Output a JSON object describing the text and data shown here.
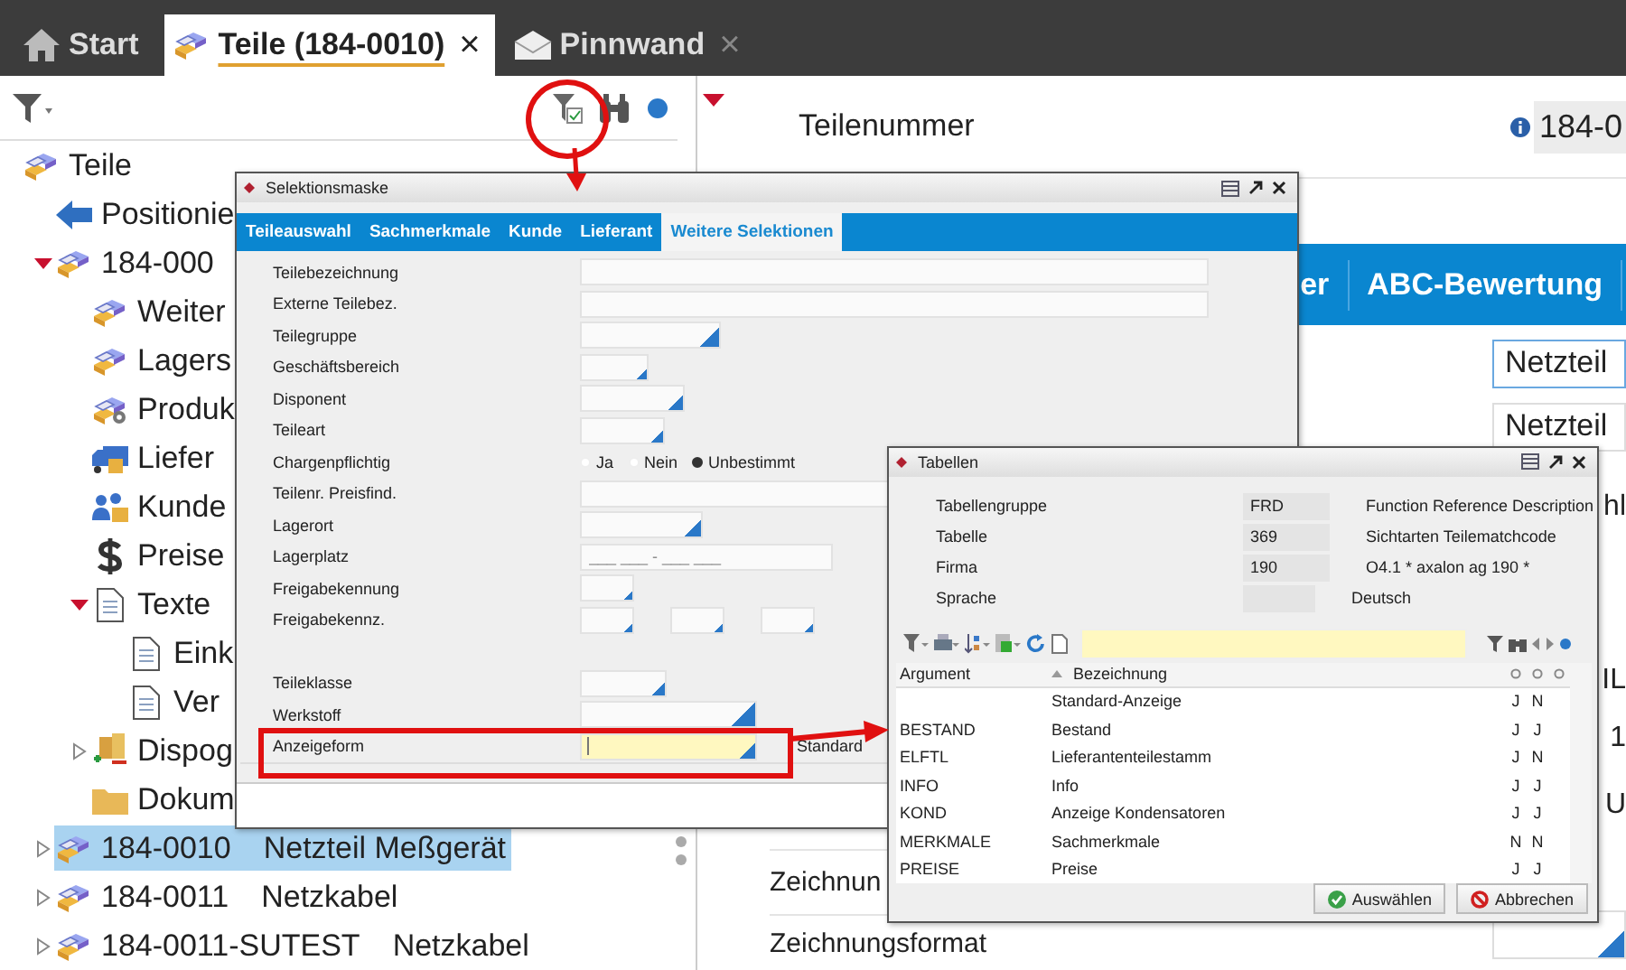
{
  "tabs": [
    {
      "label": "Start",
      "kind": "home",
      "selected": false
    },
    {
      "label": "Teile (184-0010)",
      "kind": "parts",
      "selected": true,
      "close": "×"
    },
    {
      "label": "Pinnwand",
      "kind": "mail",
      "selected": false,
      "close": "×"
    }
  ],
  "tree": [
    {
      "label": "Teile",
      "kind": "parts",
      "selected": false,
      "children": [
        {
          "label": "Positionie",
          "kind": "arrow",
          "selected": false
        },
        {
          "label": "184-000",
          "kind": "parts",
          "selected": false,
          "expanded": true,
          "children": [
            {
              "label": "Weiter",
              "kind": "parts",
              "selected": false
            },
            {
              "label": "Lagers",
              "kind": "parts",
              "selected": false
            },
            {
              "label": "Produk",
              "kind": "parts-gear",
              "selected": false
            },
            {
              "label": "Liefer",
              "kind": "truck",
              "selected": false
            },
            {
              "label": "Kunde",
              "kind": "people",
              "selected": false
            },
            {
              "label": "Preise",
              "kind": "dollar",
              "selected": false
            },
            {
              "label": "Texte",
              "kind": "doc",
              "selected": false,
              "expanded": true,
              "children": [
                {
                  "label": "Eink",
                  "kind": "doc",
                  "selected": false
                },
                {
                  "label": "Ver",
                  "kind": "doc",
                  "selected": false
                }
              ]
            },
            {
              "label": "Dispog",
              "kind": "stock",
              "selected": false,
              "expanded": false
            },
            {
              "label": "Dokum",
              "kind": "folder",
              "selected": false
            }
          ]
        },
        {
          "label": "184-0010",
          "detail": "Netzteil Meßgerät",
          "kind": "parts",
          "selected": true,
          "expanded": false
        },
        {
          "label": "184-0011",
          "detail": "Netzkabel",
          "kind": "parts",
          "selected": false,
          "expanded": false
        },
        {
          "label": "184-0011-SUTEST",
          "detail": "Netzkabel",
          "kind": "parts",
          "selected": false,
          "expanded": false
        }
      ]
    }
  ],
  "part_number": {
    "label": "Teilenummer",
    "value": "184-0"
  },
  "detail_tabs": [
    {
      "label": "er",
      "selected": false
    },
    {
      "label": "ABC-Bewertung",
      "selected": false
    }
  ],
  "detail_fields": [
    {
      "value": "Netzteil",
      "focused": true
    },
    {
      "value": "Netzteil",
      "focused": false
    }
  ],
  "cut_labels": [
    "hl",
    "IL",
    "1",
    "U"
  ],
  "drawing_rows": [
    {
      "label": "Zeichnun"
    },
    {
      "label": "Zeichnungsformat"
    }
  ],
  "selection_dialog": {
    "title": "Selektionsmaske",
    "tabs": [
      {
        "label": "Teileauswahl",
        "selected": false
      },
      {
        "label": "Sachmerkmale",
        "selected": false
      },
      {
        "label": "Kunde",
        "selected": false
      },
      {
        "label": "Lieferant",
        "selected": false
      },
      {
        "label": "Weitere Selektionen",
        "selected": true
      }
    ],
    "fields": [
      {
        "label": "Teilebezeichnung",
        "kind": "text",
        "focused": false
      },
      {
        "label": "Externe Teilebez.",
        "kind": "text",
        "focused": false
      },
      {
        "label": "Teilegruppe",
        "kind": "combo",
        "focused": false
      },
      {
        "label": "Geschäftsbereich",
        "kind": "combo",
        "focused": false
      },
      {
        "label": "Disponent",
        "kind": "combo",
        "focused": false
      },
      {
        "label": "Teileart",
        "kind": "combo",
        "focused": false
      },
      {
        "label": "Chargenpflichtig",
        "kind": "radio",
        "options": [
          {
            "label": "Ja",
            "selected": false
          },
          {
            "label": "Nein",
            "selected": false
          },
          {
            "label": "Unbestimmt",
            "selected": true
          }
        ]
      },
      {
        "label": "Teilenr. Preisfind.",
        "kind": "text",
        "focused": false
      },
      {
        "label": "Lagerort",
        "kind": "combo",
        "focused": false
      },
      {
        "label": "Lagerplatz",
        "kind": "mask",
        "placeholder": "___ ___ - ___ ___",
        "focused": false
      },
      {
        "label": "Freigabekennung",
        "kind": "combo",
        "focused": false
      },
      {
        "label": "Freigabekennz.",
        "kind": "triple",
        "focused": false
      },
      {
        "label": "Teileklasse",
        "kind": "combo",
        "focused": false
      },
      {
        "label": "Werkstoff",
        "kind": "combo",
        "focused": false
      },
      {
        "label": "Anzeigeform",
        "kind": "combo",
        "focused": true,
        "suffix": "Standard"
      }
    ]
  },
  "table_dialog": {
    "title": "Tabellen",
    "header": [
      {
        "label": "Tabellengruppe",
        "value": "FRD",
        "description": "Function Reference Description"
      },
      {
        "label": "Tabelle",
        "value": "369",
        "description": "Sichtarten Teilematchcode"
      },
      {
        "label": "Firma",
        "value": "190",
        "description": "O4.1 * axalon ag 190 *"
      },
      {
        "label": "Sprache",
        "description": "Deutsch"
      }
    ],
    "columns": [
      "Argument",
      "Bezeichnung"
    ],
    "rows": [
      {
        "name": "Standard-Anzeige",
        "flags": [
          "J",
          "N"
        ]
      },
      {
        "argument": "BESTAND",
        "name": "Bestand",
        "flags": [
          "J",
          "J"
        ]
      },
      {
        "argument": "ELFTL",
        "name": "Lieferantenteilestamm",
        "flags": [
          "J",
          "N"
        ]
      },
      {
        "argument": "INFO",
        "name": "Info",
        "flags": [
          "J",
          "J"
        ]
      },
      {
        "argument": "KOND",
        "name": "Anzeige Kondensatoren",
        "flags": [
          "J",
          "J"
        ]
      },
      {
        "argument": "MERKMALE",
        "name": "Sachmerkmale",
        "flags": [
          "N",
          "N"
        ]
      },
      {
        "argument": "PREISE",
        "name": "Preise",
        "flags": [
          "J",
          "J"
        ]
      }
    ],
    "buttons": [
      {
        "label": "Auswählen",
        "kind": "ok"
      },
      {
        "label": "Abbrechen",
        "kind": "cancel"
      }
    ]
  }
}
